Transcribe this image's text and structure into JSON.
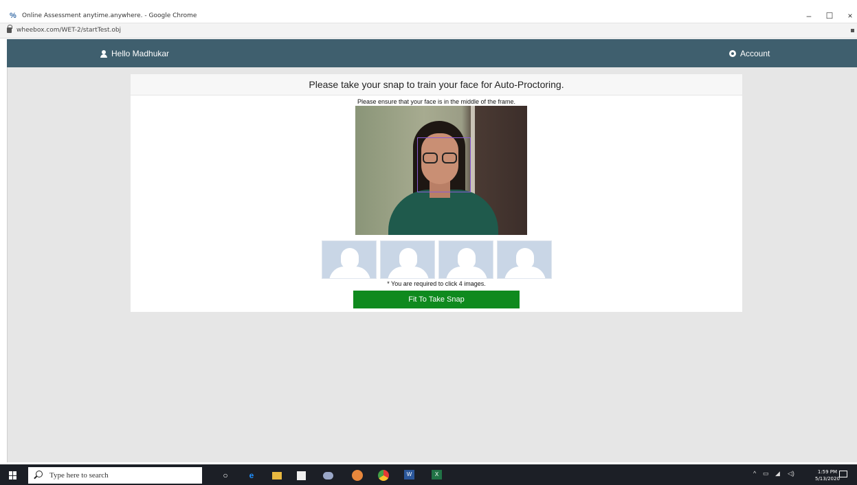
{
  "browser": {
    "window_title": "Online Assessment anytime.anywhere. - Google Chrome",
    "url": "wheebox.com/WET-2/startTest.obj",
    "controls": {
      "minimize": "–",
      "maximize": "☐",
      "close": "×"
    }
  },
  "navbar": {
    "user_label": "Hello Madhukar",
    "account_label": "Account",
    "bg_color": "#3f5f6e"
  },
  "card": {
    "header": "Please take your snap to train your face for Auto-Proctoring.",
    "instruction": "Please ensure that your face is in the middle of the frame.",
    "thumbnail_count": 4,
    "required_note": "* You are required to click 4 images.",
    "snap_button_label": "Fit To Take Snap",
    "button_color": "#0f8a1e"
  },
  "taskbar": {
    "search_placeholder": "Type here to search",
    "apps": [
      "cortana-icon",
      "edge-icon",
      "file-explorer-icon",
      "store-icon",
      "app-icon",
      "app-icon",
      "chrome-icon",
      "word-icon",
      "excel-icon"
    ],
    "clock_time": "1:59 PM",
    "clock_date": "5/13/2020"
  }
}
